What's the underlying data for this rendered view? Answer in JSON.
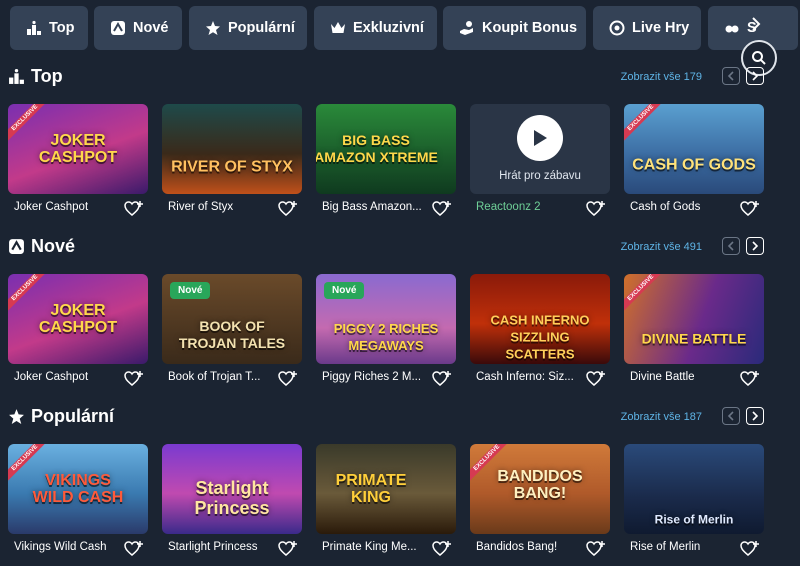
{
  "nav": {
    "tabs": [
      {
        "label": "Top",
        "icon": "podium-icon"
      },
      {
        "label": "Nové",
        "icon": "new-icon"
      },
      {
        "label": "Populární",
        "icon": "star-icon"
      },
      {
        "label": "Exkluzivní",
        "icon": "crown-icon"
      },
      {
        "label": "Koupit Bonus",
        "icon": "hand-coin-icon"
      },
      {
        "label": "Live Hry",
        "icon": "chip-icon"
      },
      {
        "label": "S",
        "icon": "slots-icon"
      }
    ]
  },
  "sections": [
    {
      "title": "Top",
      "view_all": "Zobrazit vše 179",
      "cards": [
        {
          "name": "Joker Cashpot",
          "art": "JOKER\nCASHPOT",
          "badge": "EXCLUSIVE"
        },
        {
          "name": "River of Styx",
          "art": "RIVER OF STYX",
          "badge": ""
        },
        {
          "name": "Big Bass Amazon...",
          "art": "BIG BASS\nAMAZON XTREME",
          "badge": ""
        },
        {
          "name": "Reactoonz 2",
          "art": "",
          "badge": "",
          "play": "Hrát pro zábavu"
        },
        {
          "name": "Cash of Gods",
          "art": "CASH OF GODS",
          "badge": "EXCLUSIVE"
        }
      ]
    },
    {
      "title": "Nové",
      "view_all": "Zobrazit vše 491",
      "cards": [
        {
          "name": "Joker Cashpot",
          "art": "JOKER\nCASHPOT",
          "badge": "EXCLUSIVE"
        },
        {
          "name": "Book of Trojan T...",
          "art": "BOOK OF\nTROJAN TALES",
          "badge": "Nové"
        },
        {
          "name": "Piggy Riches 2 M...",
          "art": "PIGGY 2 RICHES\nMEGAWAYS",
          "badge": "Nové"
        },
        {
          "name": "Cash Inferno: Siz...",
          "art": "CASH INFERNO\nSIZZLING SCATTERS",
          "badge": ""
        },
        {
          "name": "Divine Battle",
          "art": "DIVINE BATTLE",
          "badge": "EXCLUSIVE"
        }
      ]
    },
    {
      "title": "Populární",
      "view_all": "Zobrazit vše 187",
      "cards": [
        {
          "name": "Vikings Wild Cash",
          "art": "VIKINGS\nWILD CASH",
          "badge": "EXCLUSIVE"
        },
        {
          "name": "Starlight Princess",
          "art": "Starlight\nPrincess",
          "badge": ""
        },
        {
          "name": "Primate King Me...",
          "art": "PRIMATE\nKING",
          "badge": ""
        },
        {
          "name": "Bandidos Bang!",
          "art": "BANDIDOS\nBANG!",
          "badge": "EXCLUSIVE"
        },
        {
          "name": "Rise of Merlin",
          "art": "Rise of Merlin",
          "badge": ""
        }
      ]
    }
  ],
  "colors": {
    "background": "#1b2432",
    "tab": "#344256",
    "link": "#5fb4e6",
    "exclusive": "#d63a52",
    "new": "#29a65a",
    "highlight_name": "#6fcf97"
  }
}
